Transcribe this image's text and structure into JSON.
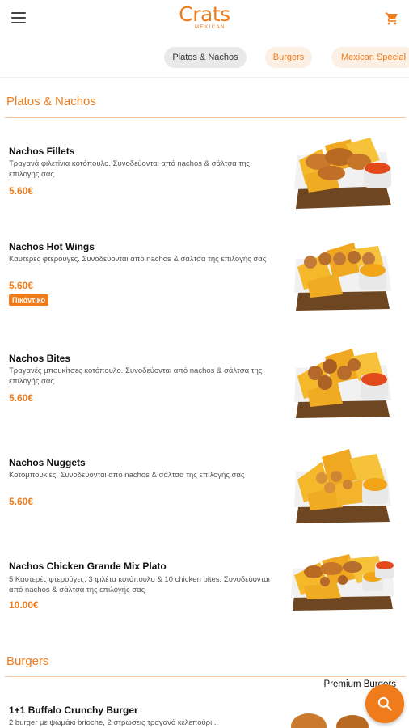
{
  "header": {
    "logo_main": "Crats",
    "logo_sub": "MEXICAN"
  },
  "tabs": [
    {
      "label": "Platos & Nachos",
      "active": true
    },
    {
      "label": "Burgers",
      "active": false
    },
    {
      "label": "Mexican Special",
      "active": false
    }
  ],
  "sections": [
    {
      "title": "Platos & Nachos",
      "items": [
        {
          "name": "Nachos Fillets",
          "description": "Τραγανά φιλετίνια κοτόπουλο. Συνοδεύονται από nachos & σάλτσα της επιλογής σας",
          "price": "5.60€"
        },
        {
          "name": "Nachos Hot Wings",
          "description": "Καυτερές φτερούγες. Συνοδεύονται από nachos & σάλτσα της επιλογής σας",
          "price": "5.60€",
          "badge": "Πικάντικο"
        },
        {
          "name": "Nachos Bites",
          "description": "Τραγανές μπουκίτσες κοτόπουλο. Συνοδεύονται από nachos & σάλτσα της επιλογής σας",
          "price": "5.60€"
        },
        {
          "name": "Nachos Nuggets",
          "description": "Κοτομπουκιές. Συνοδεύονται από nachos & σάλτσα της επιλογής σας",
          "price": "5.60€"
        },
        {
          "name": "Nachos Chicken Grande Mix Plato",
          "description": "5 Καυτερές φτερούγες, 3 φιλέτα κοτόπουλο & 10 chicken bites. Συνοδεύονται από nachos & σάλτσα της επιλογής σας",
          "price": "10.00€"
        }
      ]
    },
    {
      "title": "Burgers",
      "subcategory": "Premium Burgers",
      "items": [
        {
          "name": "1+1 Buffalo Crunchy Burger",
          "description": "2 burger με ψωμάκι brioche, 2 στρώσεις τραγανό κελεπούρι..."
        }
      ]
    }
  ],
  "colors": {
    "accent": "#f07b1b",
    "badge": "#f07b1b",
    "tab_inactive_bg": "#fcefe3",
    "tab_active_bg": "#e9e9e9"
  },
  "icons": {
    "menu": "hamburger-menu-icon",
    "cart": "shopping-cart-icon",
    "search": "search-icon"
  }
}
